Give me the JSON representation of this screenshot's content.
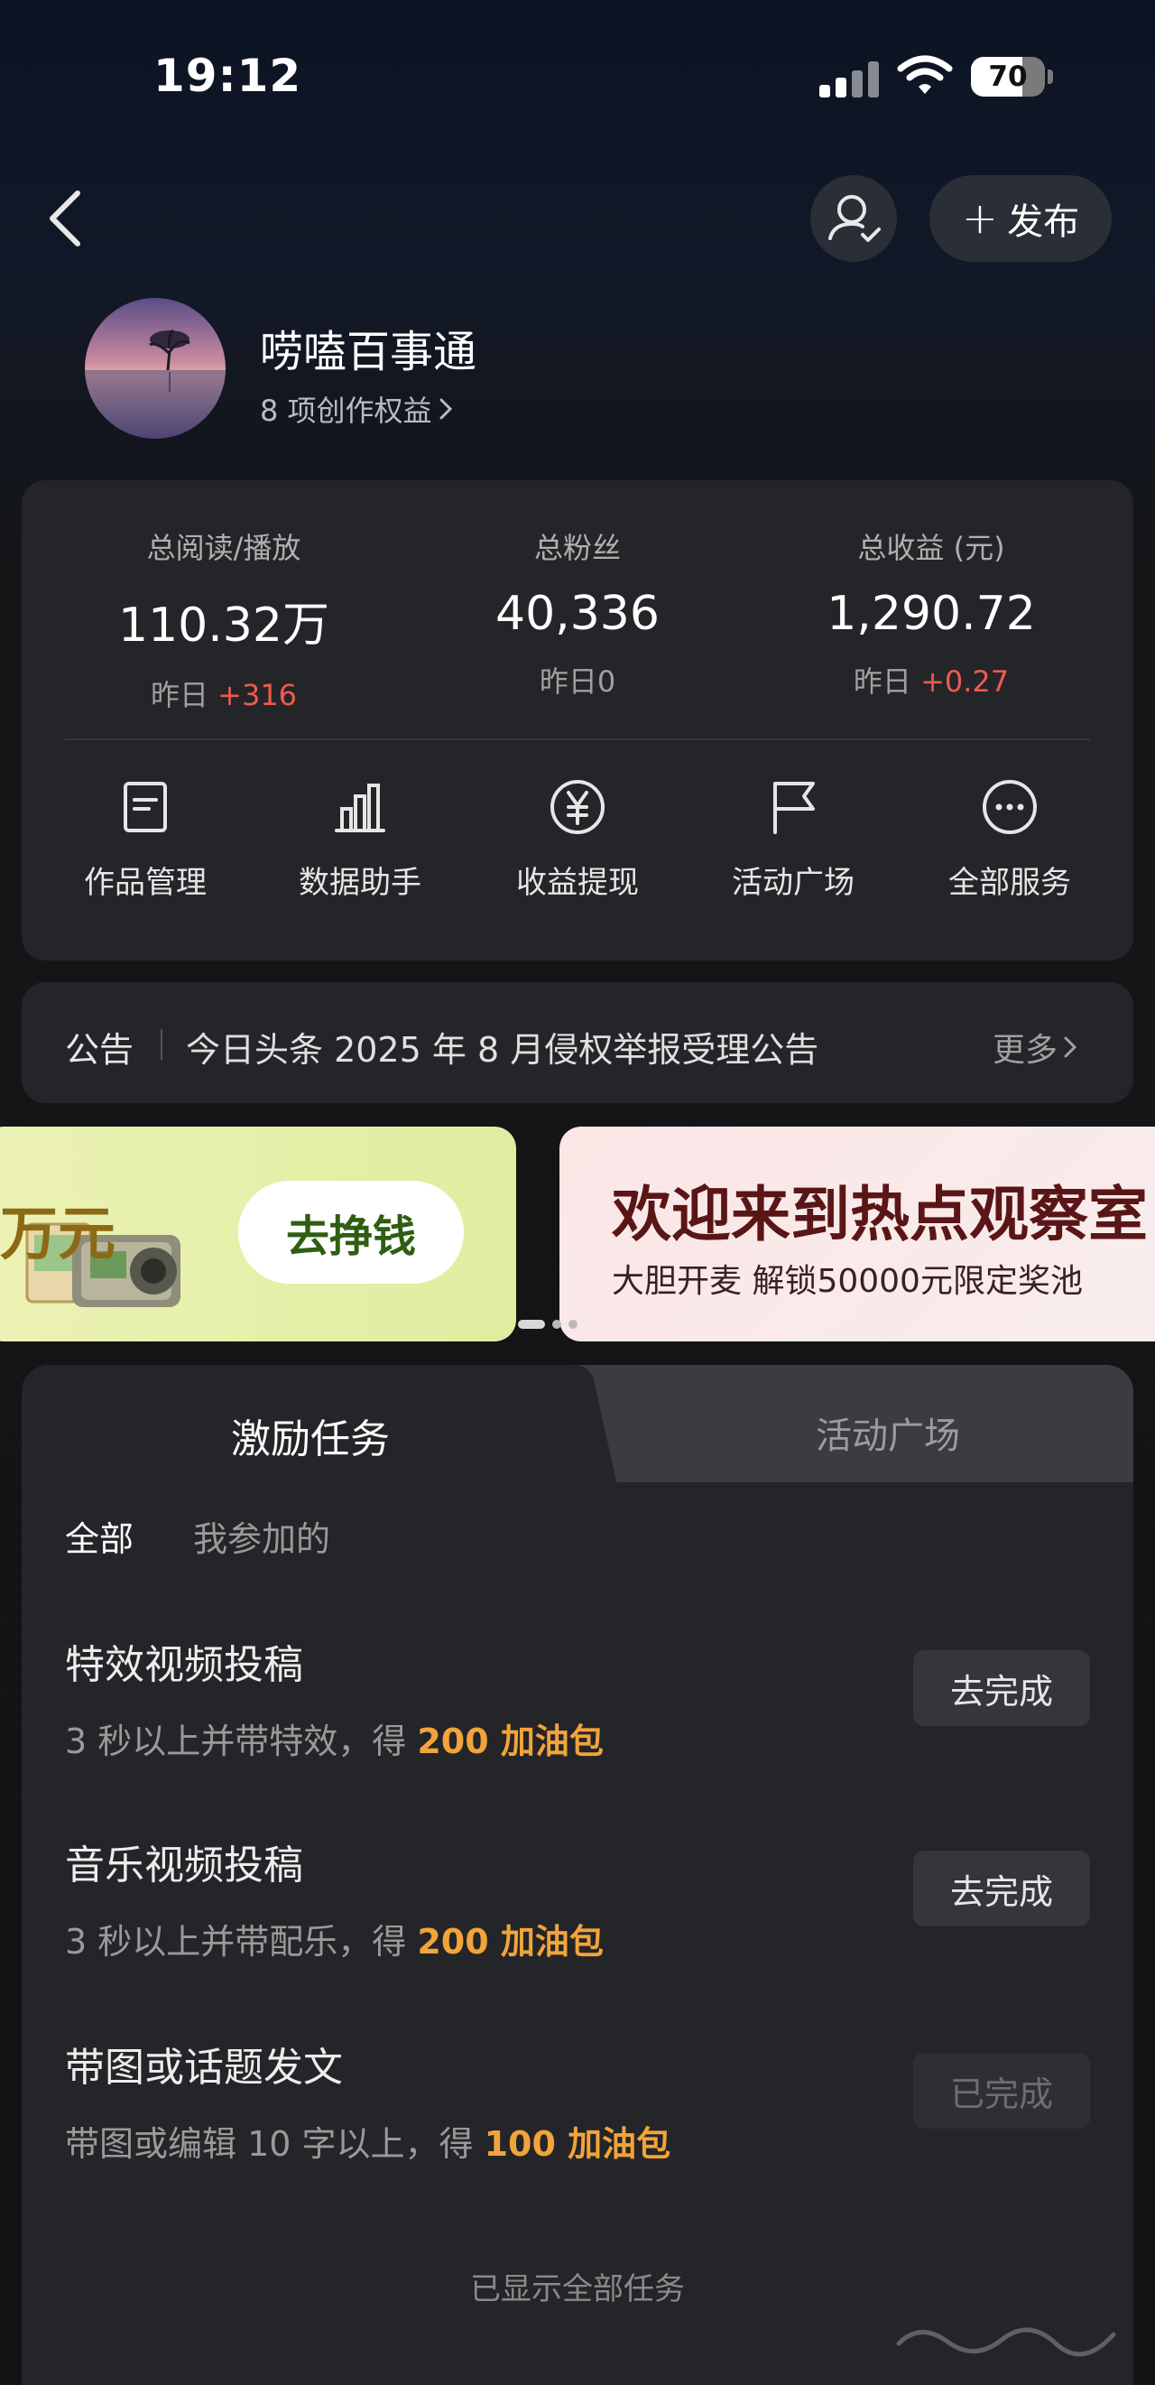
{
  "status_bar": {
    "time": "19:12",
    "battery": "70",
    "battery_level": 0.7
  },
  "header": {
    "back_icon": "chevron-left-icon",
    "user_icon": "user-check-icon",
    "publish_label": "发布"
  },
  "profile": {
    "name": "唠嗑百事通",
    "rights_text": "8 项创作权益"
  },
  "stats": [
    {
      "label": "总阅读/播放",
      "value": "110.32万",
      "delta_prefix": "昨日",
      "delta": "+316"
    },
    {
      "label": "总粉丝",
      "value": "40,336",
      "delta_prefix": "昨日",
      "delta": "0"
    },
    {
      "label": "总收益 (元)",
      "value": "1,290.72",
      "delta_prefix": "昨日",
      "delta": "+0.27"
    }
  ],
  "services": [
    {
      "label": "作品管理",
      "icon": "document-icon"
    },
    {
      "label": "数据助手",
      "icon": "bar-chart-icon"
    },
    {
      "label": "收益提现",
      "icon": "yuan-circle-icon"
    },
    {
      "label": "活动广场",
      "icon": "flag-icon"
    },
    {
      "label": "全部服务",
      "icon": "more-circle-icon"
    }
  ],
  "notice": {
    "tag": "公告",
    "text": "今日头条 2025 年 8 月侵权举报受理公告",
    "more": "更多"
  },
  "banners": {
    "left_title_fragment": "万元",
    "left_button": "去挣钱",
    "right_title": "欢迎来到热点观察室",
    "right_subtitle": "大胆开麦 解锁50000元限定奖池"
  },
  "tasks_panel": {
    "tabs": [
      "激励任务",
      "活动广场"
    ],
    "filters": [
      "全部",
      "我参加的"
    ],
    "tasks": [
      {
        "title": "特效视频投稿",
        "desc_prefix": "3 秒以上并带特效，得 ",
        "reward": "200 加油包",
        "button": "去完成",
        "done": false
      },
      {
        "title": "音乐视频投稿",
        "desc_prefix": "3 秒以上并带配乐，得 ",
        "reward": "200 加油包",
        "button": "去完成",
        "done": false
      },
      {
        "title": "带图或话题发文",
        "desc_prefix": "带图或编辑 10 字以上，得 ",
        "reward": "100 加油包",
        "button": "已完成",
        "done": true
      }
    ],
    "footer": "已显示全部任务"
  },
  "colors": {
    "accent_red": "#f05a4f",
    "reward_orange": "#f2a33a",
    "card_bg": "#242528"
  }
}
